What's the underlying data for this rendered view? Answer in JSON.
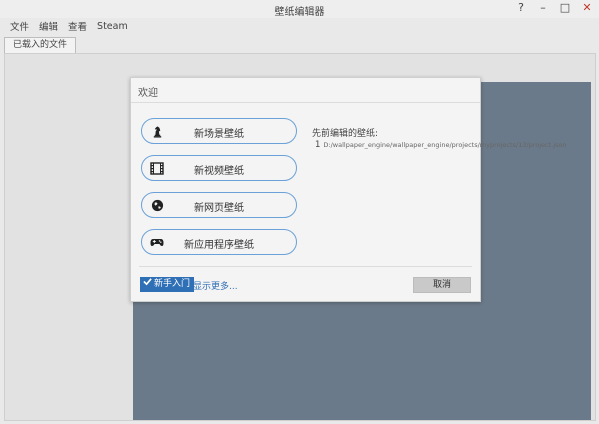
{
  "window": {
    "title": "壁纸编辑器",
    "controls": [
      "?",
      "–",
      "□",
      "✕"
    ]
  },
  "menu": {
    "items": [
      "文件",
      "编辑",
      "查看",
      "Steam"
    ]
  },
  "tabs": [
    {
      "label": "已载入的文件"
    }
  ],
  "dialog": {
    "title": "欢迎",
    "options": [
      {
        "label": "新场景壁纸",
        "icon": "chess-knight-icon"
      },
      {
        "label": "新视频壁纸",
        "icon": "film-icon"
      },
      {
        "label": "新网页壁纸",
        "icon": "globe-icon"
      },
      {
        "label": "新应用程序壁纸",
        "icon": "gamepad-icon"
      }
    ],
    "recent": {
      "title": "先前编辑的壁纸:",
      "items": [
        {
          "num": "1",
          "path": "D:/wallpaper_engine/wallpaper_engine/projects/myprojects/13/project.json"
        }
      ]
    },
    "footer": {
      "beginner_label": "新手入门",
      "more_label": "显示更多...",
      "cancel_label": "取消"
    }
  },
  "colors": {
    "accent": "#2f6fb6",
    "option_border": "#6aa1d8",
    "canvas": "#6b7a8a"
  }
}
